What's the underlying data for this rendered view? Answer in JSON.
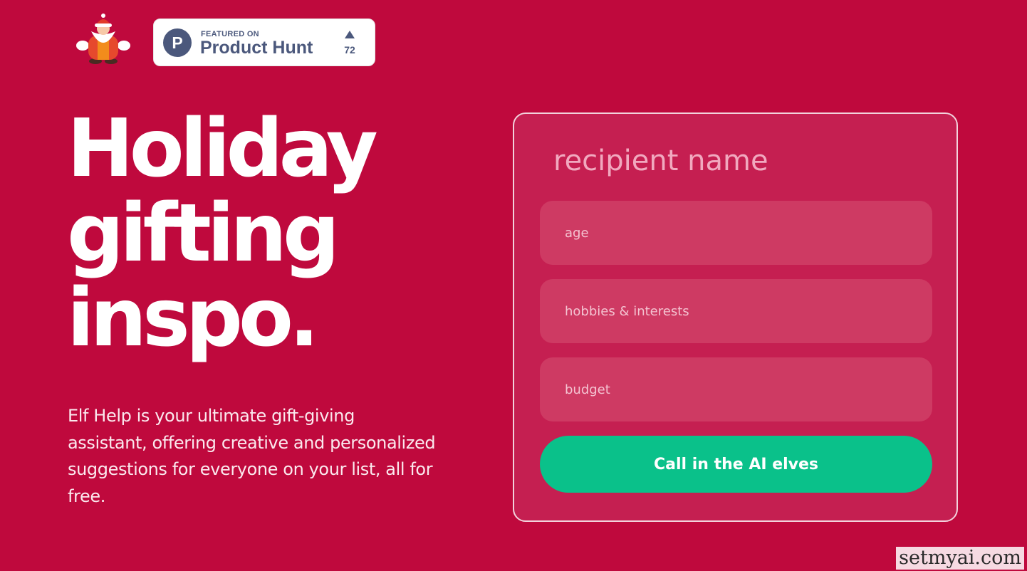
{
  "logo": {
    "icon": "santa-elf-icon"
  },
  "product_hunt": {
    "logo_letter": "P",
    "featured": "FEATURED ON",
    "name": "Product Hunt",
    "upvotes": "72"
  },
  "hero": {
    "line1": "Holiday",
    "line2": "gifting",
    "line3": "inspo.",
    "description": "Elf Help is your ultimate gift-giving assistant, offering creative and personalized suggestions for everyone on your list, all for free."
  },
  "form": {
    "name_placeholder": "recipient name",
    "age_placeholder": "age",
    "hobbies_placeholder": "hobbies & interests",
    "budget_placeholder": "budget",
    "submit_label": "Call in the AI elves"
  },
  "watermark": "setmyai.com",
  "colors": {
    "background": "#bf093d",
    "card": "#c51f51",
    "field": "#ce3a63",
    "button": "#0ac18a",
    "product_hunt": "#4b587c"
  }
}
